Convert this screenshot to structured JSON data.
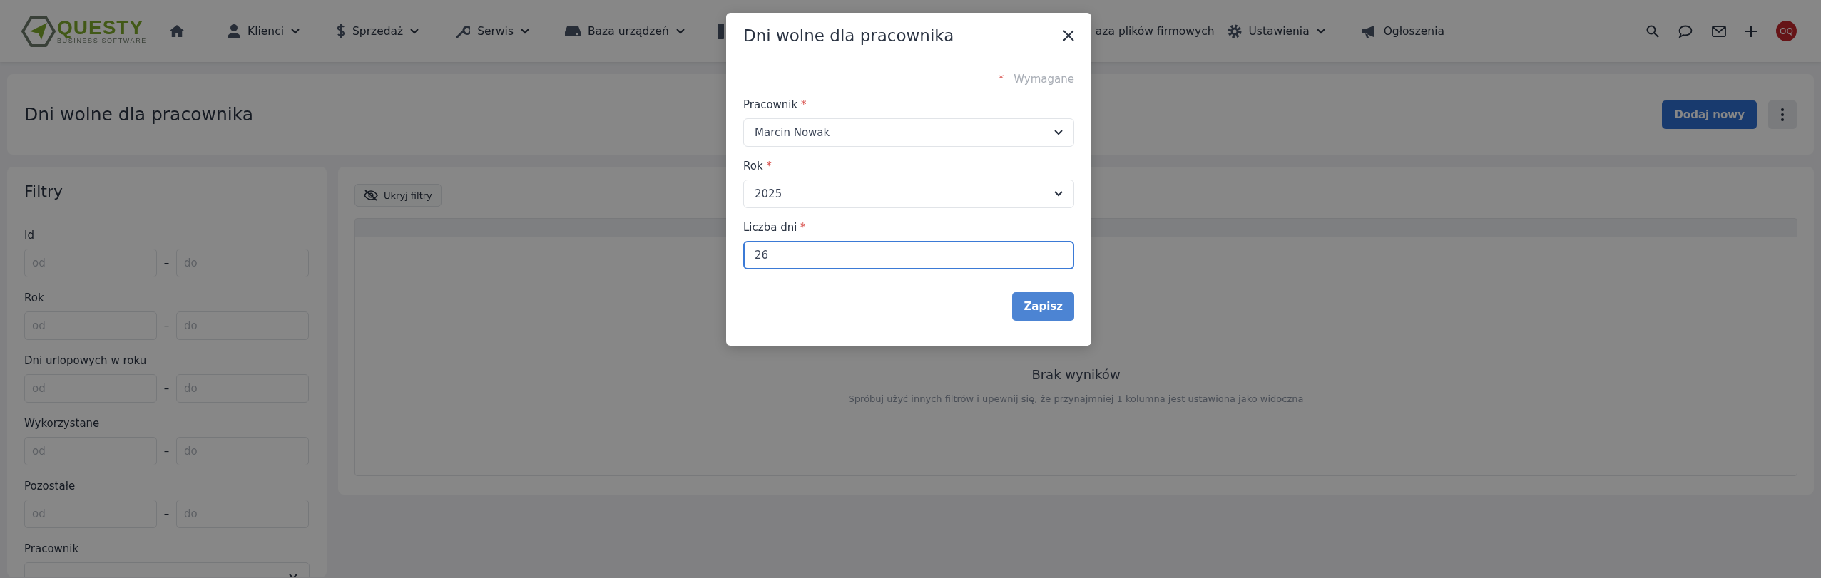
{
  "nav": {
    "logo": {
      "name": "QUESTY",
      "tagline": "BUSINESS SOFTWARE"
    },
    "items": [
      {
        "label": "Klienci",
        "dropdown": true
      },
      {
        "label": "Sprzedaż",
        "dropdown": true
      },
      {
        "label": "Serwis",
        "dropdown": true
      },
      {
        "label": "Baza urządzeń",
        "dropdown": true
      },
      {
        "label": "aza plików firmowych",
        "dropdown": false
      },
      {
        "label": "Ustawienia",
        "dropdown": true
      },
      {
        "label": "Ogłoszenia",
        "dropdown": false
      }
    ],
    "avatar": "OQ"
  },
  "page_header": {
    "title": "Dni wolne dla pracownika",
    "add_button": "Dodaj nowy"
  },
  "filters": {
    "title": "Filtry",
    "items": [
      {
        "kind": "range",
        "label": "Id",
        "from_placeholder": "od",
        "separator": "–",
        "to_placeholder": "do"
      },
      {
        "kind": "range",
        "label": "Rok",
        "from_placeholder": "od",
        "separator": "–",
        "to_placeholder": "do"
      },
      {
        "kind": "range",
        "label": "Dni urlopowych w roku",
        "from_placeholder": "od",
        "separator": "–",
        "to_placeholder": "do"
      },
      {
        "kind": "range",
        "label": "Wykorzystane",
        "from_placeholder": "od",
        "separator": "–",
        "to_placeholder": "do"
      },
      {
        "kind": "range",
        "label": "Pozostałe",
        "from_placeholder": "od",
        "separator": "–",
        "to_placeholder": "do"
      },
      {
        "kind": "select",
        "label": "Pracownik"
      }
    ]
  },
  "results": {
    "toggle_filters": "Ukryj filtry",
    "empty_title": "Brak wyników",
    "empty_text": "Spróbuj użyć innych filtrów i upewnij się, że przynajmniej 1 kolumna jest ustawiona jako widoczna"
  },
  "modal": {
    "title": "Dni wolne dla pracownika",
    "required_legend": {
      "mark": "*",
      "text": "Wymagane"
    },
    "fields": [
      {
        "kind": "select",
        "label": "Pracownik",
        "required_mark": "*",
        "value": "Marcin Nowak",
        "focused": false
      },
      {
        "kind": "select",
        "label": "Rok",
        "required_mark": "*",
        "value": "2025",
        "focused": false
      },
      {
        "kind": "input",
        "label": "Liczba dni",
        "required_mark": "*",
        "value": "26",
        "focused": true
      }
    ],
    "save_button": "Zapisz"
  }
}
